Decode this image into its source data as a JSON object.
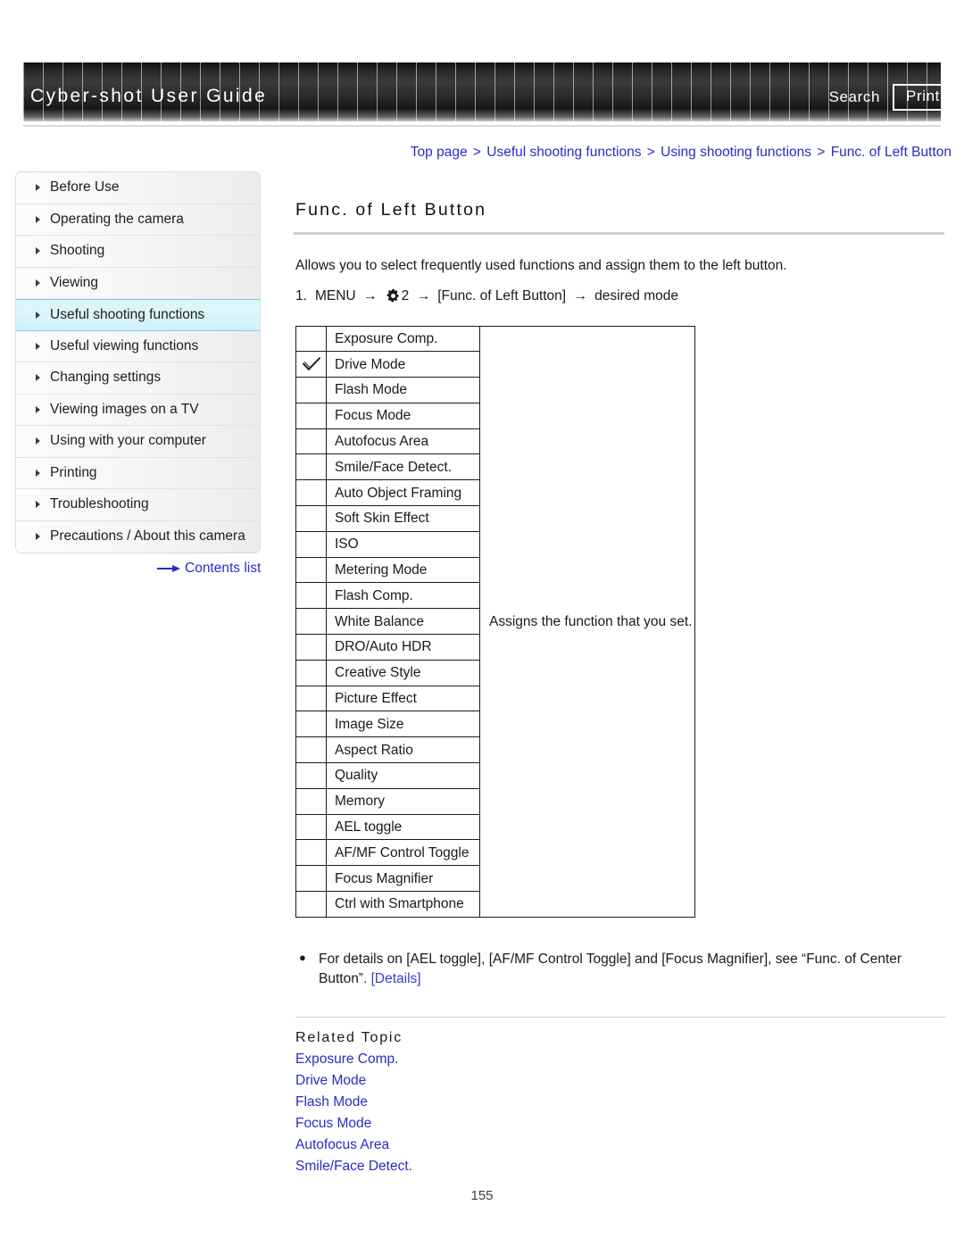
{
  "header": {
    "title": "Cyber-shot User Guide",
    "search_label": "Search",
    "print_label": "Print"
  },
  "breadcrumb": {
    "items": [
      "Top page",
      "Useful shooting functions",
      "Using shooting functions",
      "Func. of Left Button"
    ],
    "separator": ">"
  },
  "sidebar": {
    "items": [
      {
        "label": "Before Use",
        "active": false
      },
      {
        "label": "Operating the camera",
        "active": false
      },
      {
        "label": "Shooting",
        "active": false
      },
      {
        "label": "Viewing",
        "active": false
      },
      {
        "label": "Useful shooting functions",
        "active": true
      },
      {
        "label": "Useful viewing functions",
        "active": false
      },
      {
        "label": "Changing settings",
        "active": false
      },
      {
        "label": "Viewing images on a TV",
        "active": false
      },
      {
        "label": "Using with your computer",
        "active": false
      },
      {
        "label": "Printing",
        "active": false
      },
      {
        "label": "Troubleshooting",
        "active": false
      },
      {
        "label": "Precautions / About this camera",
        "active": false
      }
    ],
    "contents_list_label": "Contents list"
  },
  "main": {
    "title": "Func. of Left Button",
    "intro": "Allows you to select frequently used functions and assign them to the left button.",
    "step": {
      "number": "1.",
      "menu_label": "MENU",
      "arrow": "→",
      "gear_icon": "gear-icon",
      "menu_tab": "2",
      "bracket_item": "[Func. of Left Button]",
      "final": "desired mode"
    },
    "table": {
      "description": "Assigns the function that you set.",
      "rows": [
        {
          "label": "Exposure Comp.",
          "checked": false
        },
        {
          "label": "Drive Mode",
          "checked": true
        },
        {
          "label": "Flash Mode",
          "checked": false
        },
        {
          "label": "Focus Mode",
          "checked": false
        },
        {
          "label": "Autofocus Area",
          "checked": false
        },
        {
          "label": "Smile/Face Detect.",
          "checked": false
        },
        {
          "label": "Auto Object Framing",
          "checked": false
        },
        {
          "label": "Soft Skin Effect",
          "checked": false
        },
        {
          "label": "ISO",
          "checked": false
        },
        {
          "label": "Metering Mode",
          "checked": false
        },
        {
          "label": "Flash Comp.",
          "checked": false
        },
        {
          "label": "White Balance",
          "checked": false
        },
        {
          "label": "DRO/Auto HDR",
          "checked": false
        },
        {
          "label": "Creative Style",
          "checked": false
        },
        {
          "label": "Picture Effect",
          "checked": false
        },
        {
          "label": "Image Size",
          "checked": false
        },
        {
          "label": "Aspect Ratio",
          "checked": false
        },
        {
          "label": "Quality",
          "checked": false
        },
        {
          "label": "Memory",
          "checked": false
        },
        {
          "label": "AEL toggle",
          "checked": false
        },
        {
          "label": "AF/MF Control Toggle",
          "checked": false
        },
        {
          "label": "Focus Magnifier",
          "checked": false
        },
        {
          "label": "Ctrl with Smartphone",
          "checked": false
        }
      ]
    },
    "note": {
      "bullet": "●",
      "text": "For details on [AEL toggle], [AF/MF Control Toggle] and [Focus Magnifier], see “Func. of Center Button”.",
      "link": "[Details]"
    },
    "related": {
      "heading": "Related Topic",
      "links": [
        "Exposure Comp.",
        "Drive Mode",
        "Flash Mode",
        "Focus Mode",
        "Autofocus Area",
        "Smile/Face Detect."
      ]
    }
  },
  "footer": {
    "page_number": "155"
  },
  "colors": {
    "link_blue": "#2b2bc4",
    "active_sidebar": "#d8f4fb",
    "header_dark": "#2b2b2b"
  }
}
